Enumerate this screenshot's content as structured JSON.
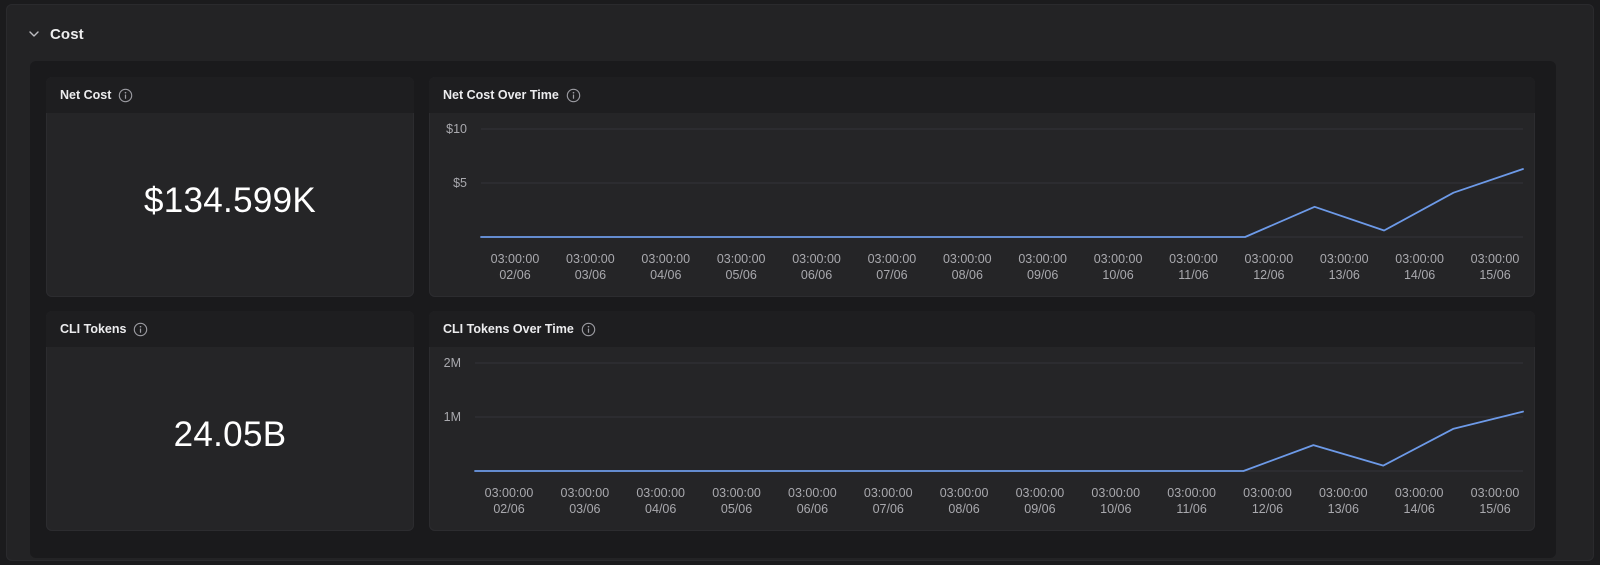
{
  "section": {
    "title": "Cost"
  },
  "net_cost": {
    "title": "Net Cost",
    "value": "$134.599K"
  },
  "cli_tokens": {
    "title": "CLI Tokens",
    "value": "24.05B"
  },
  "net_cost_chart": {
    "title": "Net Cost Over Time"
  },
  "cli_tokens_chart": {
    "title": "CLI Tokens Over Time"
  },
  "colors": {
    "line": "#6d9ae8",
    "grid": "#33343a",
    "tick": "#a9a9ae"
  },
  "chart_data": [
    {
      "type": "line",
      "title": "Net Cost Over Time",
      "x": [
        "03:00:00 02/06",
        "03:00:00 03/06",
        "03:00:00 04/06",
        "03:00:00 05/06",
        "03:00:00 06/06",
        "03:00:00 07/06",
        "03:00:00 08/06",
        "03:00:00 09/06",
        "03:00:00 10/06",
        "03:00:00 11/06",
        "03:00:00 12/06",
        "03:00:00 13/06",
        "03:00:00 14/06",
        "03:00:00 15/06"
      ],
      "y_ticks": [
        {
          "value": 5,
          "label": "$5"
        },
        {
          "value": 10,
          "label": "$10"
        }
      ],
      "ylim": [
        0,
        10
      ],
      "values": [
        0,
        0,
        0,
        0,
        0,
        0,
        0,
        0,
        0,
        0,
        0,
        0,
        2.8,
        0.6,
        4.1,
        6.3
      ],
      "grid": true
    },
    {
      "type": "line",
      "title": "CLI Tokens Over Time",
      "x": [
        "03:00:00 02/06",
        "03:00:00 03/06",
        "03:00:00 04/06",
        "03:00:00 05/06",
        "03:00:00 06/06",
        "03:00:00 07/06",
        "03:00:00 08/06",
        "03:00:00 09/06",
        "03:00:00 10/06",
        "03:00:00 11/06",
        "03:00:00 12/06",
        "03:00:00 13/06",
        "03:00:00 14/06",
        "03:00:00 15/06"
      ],
      "y_ticks": [
        {
          "value": 1000000,
          "label": "1M"
        },
        {
          "value": 2000000,
          "label": "2M"
        }
      ],
      "ylim": [
        0,
        2000000
      ],
      "values": [
        0,
        0,
        0,
        0,
        0,
        0,
        0,
        0,
        0,
        0,
        0,
        0,
        480000,
        100000,
        780000,
        1100000
      ],
      "grid": true
    }
  ]
}
